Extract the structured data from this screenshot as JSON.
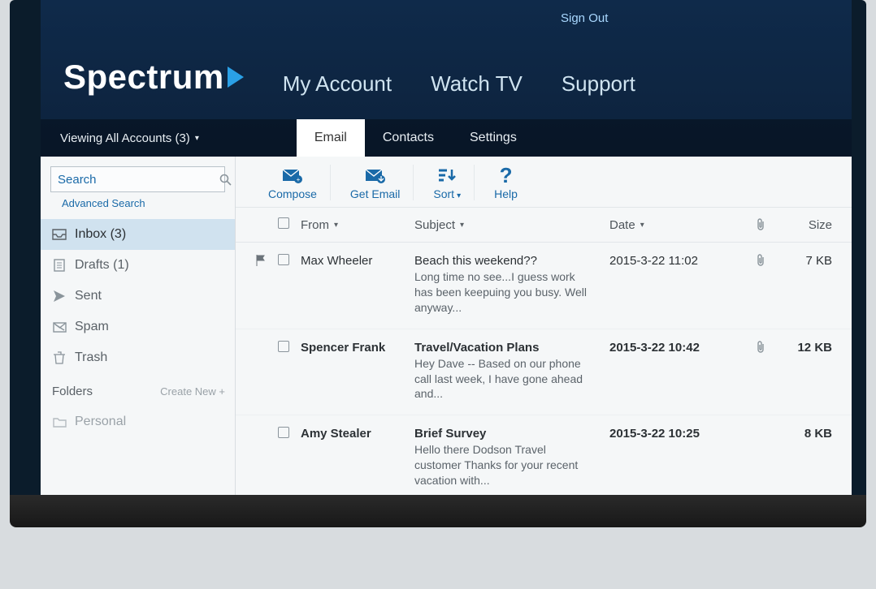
{
  "top": {
    "signout": "Sign Out"
  },
  "brand": {
    "name": "Spectrum"
  },
  "nav": {
    "my_account": "My Account",
    "watch_tv": "Watch TV",
    "support": "Support"
  },
  "accounts": {
    "label": "Viewing All Accounts (3)"
  },
  "tabs": {
    "email": "Email",
    "contacts": "Contacts",
    "settings": "Settings"
  },
  "search": {
    "placeholder": "Search",
    "advanced": "Advanced Search"
  },
  "folders": {
    "inbox": "Inbox (3)",
    "drafts": "Drafts (1)",
    "sent": "Sent",
    "spam": "Spam",
    "trash": "Trash",
    "header": "Folders",
    "create": "Create New +",
    "personal": "Personal"
  },
  "toolbar": {
    "compose": "Compose",
    "get": "Get Email",
    "sort": "Sort",
    "help": "Help"
  },
  "columns": {
    "from": "From",
    "subject": "Subject",
    "date": "Date",
    "size": "Size"
  },
  "messages": [
    {
      "flag": true,
      "bold": false,
      "from": "Max Wheeler",
      "subject": "Beach this weekend??",
      "preview": "Long time no see...I guess work has been keepuing you busy. Well anyway...",
      "date": "2015-3-22 11:02",
      "attach": true,
      "size": "7 KB"
    },
    {
      "flag": false,
      "bold": true,
      "from": "Spencer Frank",
      "subject": "Travel/Vacation Plans",
      "preview": "Hey Dave -- Based on our phone call last week, I have gone ahead and...",
      "date": "2015-3-22 10:42",
      "attach": true,
      "size": "12 KB"
    },
    {
      "flag": false,
      "bold": true,
      "from": "Amy Stealer",
      "subject": "Brief Survey",
      "preview": "Hello there Dodson Travel customer Thanks for your recent vacation with...",
      "date": "2015-3-22 10:25",
      "attach": false,
      "size": "8 KB"
    }
  ]
}
